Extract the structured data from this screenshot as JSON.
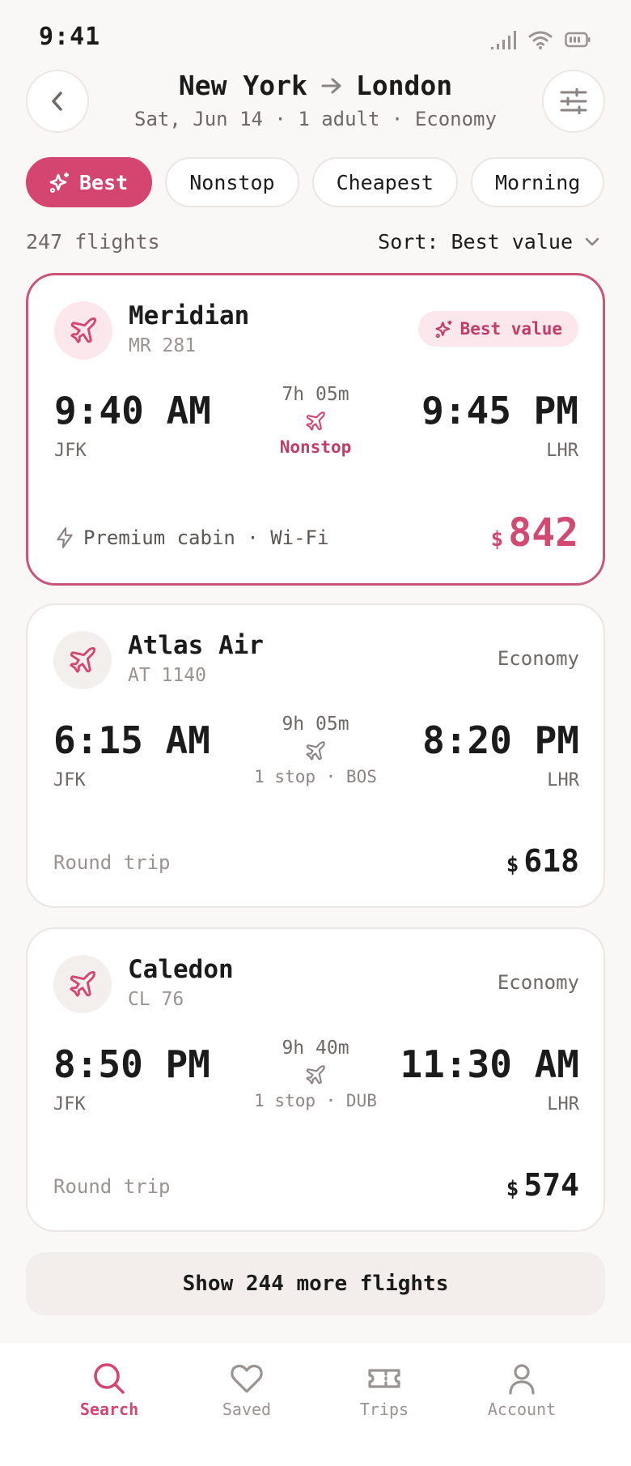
{
  "status": {
    "time": "9:41"
  },
  "header": {
    "origin": "New York",
    "destination": "London",
    "subtitle": "Sat, Jun 14 · 1 adult · Economy"
  },
  "chips": [
    "Best",
    "Nonstop",
    "Cheapest",
    "Morning"
  ],
  "results": {
    "count": "247 flights",
    "sort": "Sort: Best value"
  },
  "flights": [
    {
      "airline": "Meridian",
      "flight": "MR 281",
      "badge": "Best value",
      "dep_time": "9:40 AM",
      "dep_code": "JFK",
      "duration": "7h 05m",
      "stops": "Nonstop",
      "arr_time": "9:45 PM",
      "arr_code": "LHR",
      "perks": "Premium cabin · Wi-Fi",
      "currency": "$",
      "price": "842"
    },
    {
      "airline": "Atlas Air",
      "flight": "AT 1140",
      "cabin": "Economy",
      "dep_time": "6:15 AM",
      "dep_code": "JFK",
      "duration": "9h 05m",
      "stops": "1 stop · BOS",
      "arr_time": "8:20 PM",
      "arr_code": "LHR",
      "trip": "Round trip",
      "currency": "$",
      "price": "618"
    },
    {
      "airline": "Caledon",
      "flight": "CL 76",
      "cabin": "Economy",
      "dep_time": "8:50 PM",
      "dep_code": "JFK",
      "duration": "9h 40m",
      "stops": "1 stop · DUB",
      "arr_time": "11:30 AM",
      "arr_code": "LHR",
      "trip": "Round trip",
      "currency": "$",
      "price": "574"
    }
  ],
  "more_button": "Show 244 more flights",
  "nav": [
    {
      "label": "Search",
      "icon": "search-icon",
      "active": true
    },
    {
      "label": "Saved",
      "icon": "heart-icon"
    },
    {
      "label": "Trips",
      "icon": "ticket-icon"
    },
    {
      "label": "Account",
      "icon": "user-icon"
    }
  ],
  "colors": {
    "accent": "#d4466f",
    "background": "#faf8f7",
    "card": "#ffffff",
    "muted": "#6e6866"
  }
}
